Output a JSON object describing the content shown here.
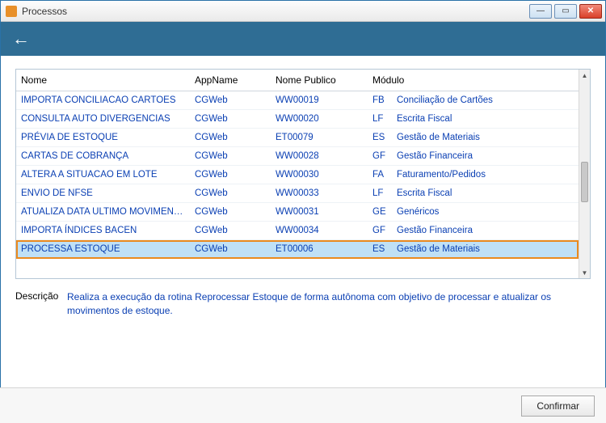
{
  "window": {
    "title": "Processos"
  },
  "grid": {
    "headers": {
      "nome": "Nome",
      "app": "AppName",
      "publico": "Nome Publico",
      "modulo": "Módulo"
    },
    "rows": [
      {
        "nome": "IMPORTA CONCILIACAO CARTOES",
        "app": "CGWeb",
        "publico": "WW00019",
        "mod_code": "FB",
        "mod_name": "Conciliação de Cartões",
        "selected": false
      },
      {
        "nome": "CONSULTA AUTO DIVERGENCIAS",
        "app": "CGWeb",
        "publico": "WW00020",
        "mod_code": "LF",
        "mod_name": "Escrita Fiscal",
        "selected": false
      },
      {
        "nome": "PRÉVIA DE ESTOQUE",
        "app": "CGWeb",
        "publico": "ET00079",
        "mod_code": "ES",
        "mod_name": "Gestão de Materiais",
        "selected": false
      },
      {
        "nome": "CARTAS DE COBRANÇA",
        "app": "CGWeb",
        "publico": "WW00028",
        "mod_code": "GF",
        "mod_name": "Gestão Financeira",
        "selected": false
      },
      {
        "nome": "ALTERA A SITUACAO EM LOTE",
        "app": "CGWeb",
        "publico": "WW00030",
        "mod_code": "FA",
        "mod_name": "Faturamento/Pedidos",
        "selected": false
      },
      {
        "nome": "ENVIO DE NFSE",
        "app": "CGWeb",
        "publico": "WW00033",
        "mod_code": "LF",
        "mod_name": "Escrita Fiscal",
        "selected": false
      },
      {
        "nome": "ATUALIZA DATA ULTIMO MOVIMENTO",
        "app": "CGWeb",
        "publico": "WW00031",
        "mod_code": "GE",
        "mod_name": "Genéricos",
        "selected": false
      },
      {
        "nome": "IMPORTA ÍNDICES BACEN",
        "app": "CGWeb",
        "publico": "WW00034",
        "mod_code": "GF",
        "mod_name": "Gestão Financeira",
        "selected": false
      },
      {
        "nome": "PROCESSA ESTOQUE",
        "app": "CGWeb",
        "publico": "ET00006",
        "mod_code": "ES",
        "mod_name": "Gestão de Materiais",
        "selected": true
      }
    ]
  },
  "description": {
    "label": "Descrição",
    "text": "Realiza a execução da rotina Reprocessar Estoque de forma autônoma com objetivo de processar e atualizar os movimentos de estoque."
  },
  "footer": {
    "confirm": "Confirmar"
  }
}
